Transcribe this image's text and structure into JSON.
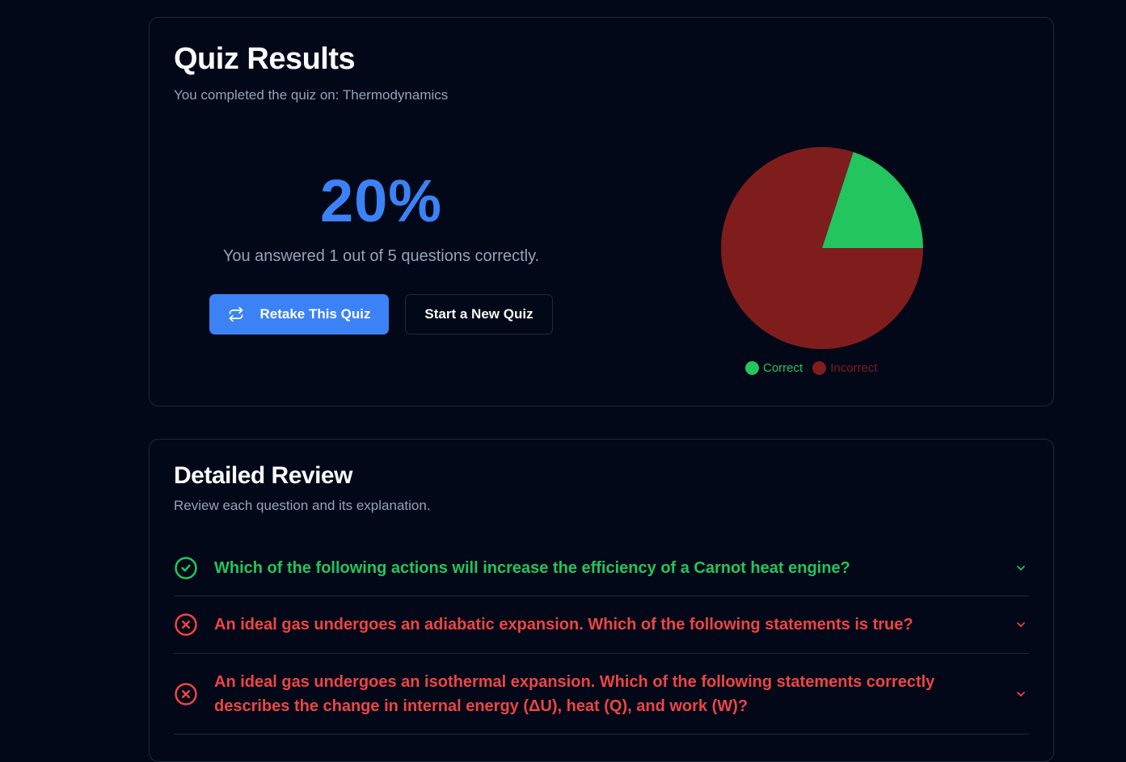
{
  "results": {
    "title": "Quiz Results",
    "subtitle": "You completed the quiz on: Thermodynamics",
    "score": "20%",
    "summary": "You answered 1 out of 5 questions correctly.",
    "retake_label": "Retake This Quiz",
    "retake_icon": "repeat-icon",
    "new_quiz_label": "Start a New Quiz"
  },
  "chart_data": {
    "type": "pie",
    "categories": [
      "Correct",
      "Incorrect"
    ],
    "values": [
      1,
      4
    ],
    "colors": [
      "#22c55e",
      "#7f1d1d"
    ],
    "legend_text_colors": [
      "#22c55e",
      "#7f1d1d"
    ],
    "legend_position": "bottom"
  },
  "review": {
    "title": "Detailed Review",
    "subtitle": "Review each question and its explanation.",
    "items": [
      {
        "status": "correct",
        "icon": "check-circle-icon",
        "question": "Which of the following actions will increase the efficiency of a Carnot heat engine?"
      },
      {
        "status": "incorrect",
        "icon": "x-circle-icon",
        "question": "An ideal gas undergoes an adiabatic expansion. Which of the following statements is true?"
      },
      {
        "status": "incorrect",
        "icon": "x-circle-icon",
        "question": "An ideal gas undergoes an isothermal expansion. Which of the following statements correctly describes the change in internal energy (ΔU), heat (Q), and work (W)?"
      }
    ]
  },
  "colors": {
    "background": "#020817",
    "accent": "#3b82f6",
    "correct": "#22c55e",
    "incorrect": "#ef4444",
    "incorrect_slice": "#7f1d1d",
    "border": "#1e293b",
    "muted_text": "#94a3b8"
  }
}
